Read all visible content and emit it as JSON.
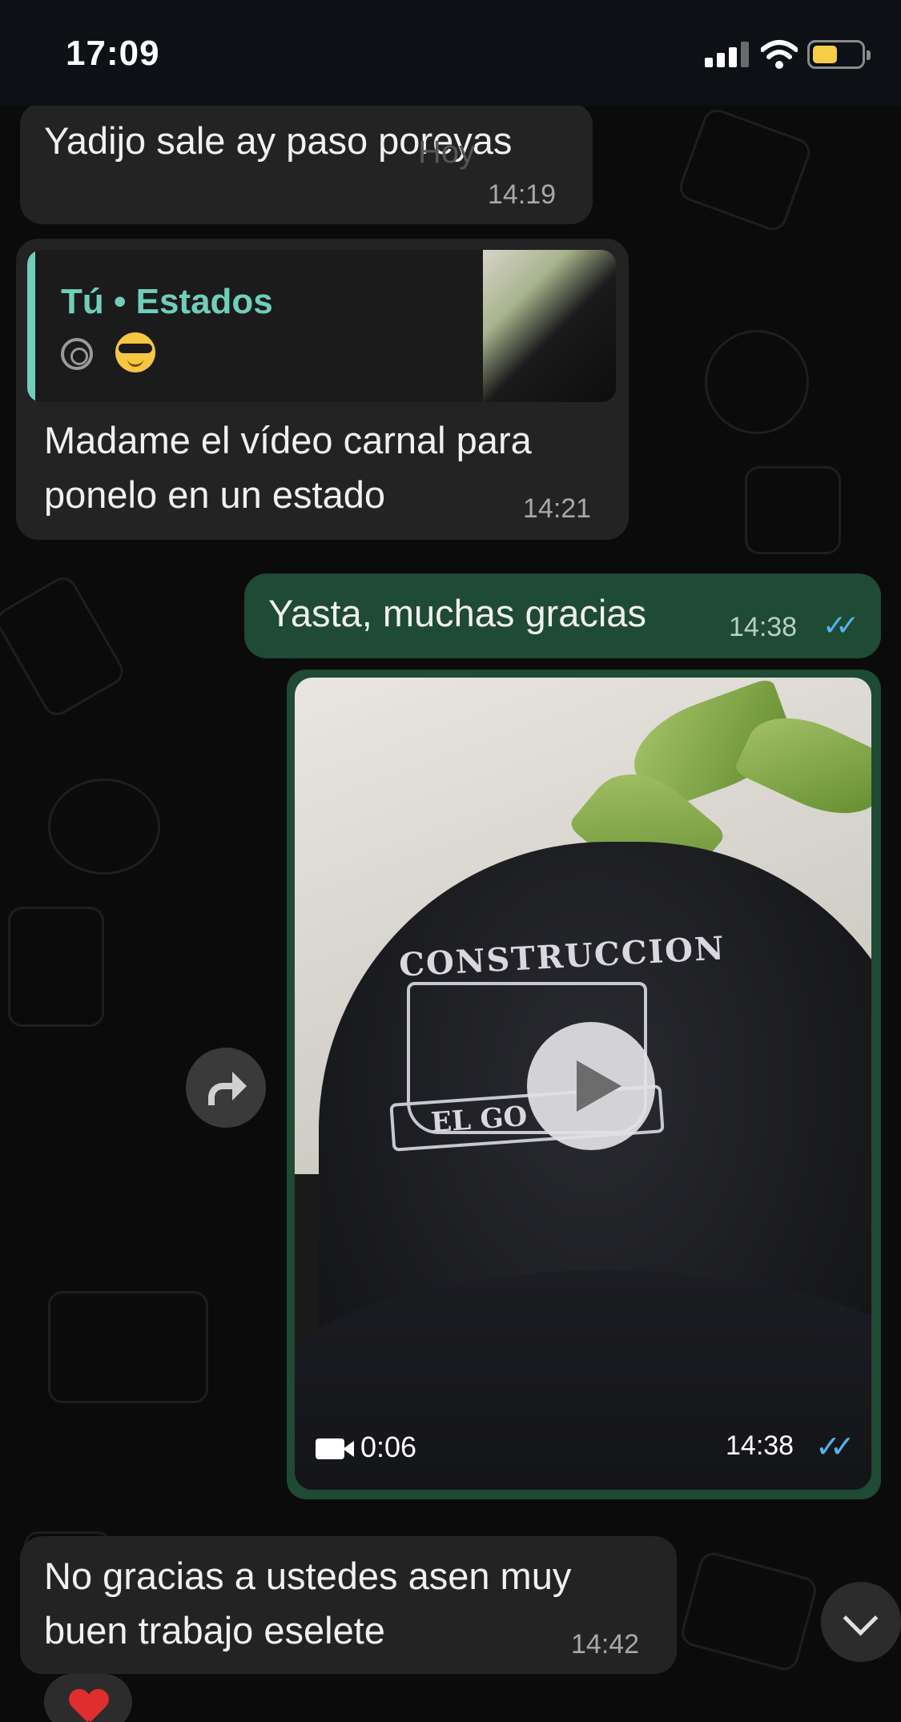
{
  "status_bar": {
    "time": "17:09"
  },
  "day_label": "Hoy",
  "messages": [
    {
      "id": "m1",
      "direction": "incoming",
      "text": "Yadijo sale ay paso poreyas",
      "time": "14:19"
    },
    {
      "id": "m2",
      "direction": "incoming",
      "reply_to": {
        "title": "Tú • Estados",
        "emoji": "sunglasses-emoji"
      },
      "text_lines": [
        "Madame el vídeo carnal para",
        "ponelo en un estado"
      ],
      "time": "14:21"
    },
    {
      "id": "m3",
      "direction": "outgoing",
      "text": "Yasta, muchas gracias",
      "time": "14:38",
      "status": "read"
    },
    {
      "id": "m4",
      "direction": "outgoing",
      "type": "video",
      "duration": "0:06",
      "time": "14:38",
      "status": "read",
      "thumbnail_text": "CONSTRUCCION",
      "thumbnail_banner": "EL GO"
    },
    {
      "id": "m5",
      "direction": "incoming",
      "text_lines": [
        "No gracias a ustedes asen muy",
        "buen trabajo eselete"
      ],
      "time": "14:42",
      "reaction": "red-heart"
    }
  ],
  "colors": {
    "incoming_bubble": "#232323",
    "outgoing_bubble": "#1f4a33",
    "quote_accent": "#6fcfb9",
    "read_ticks": "#4fb6ec",
    "background": "#0b0b0b"
  }
}
